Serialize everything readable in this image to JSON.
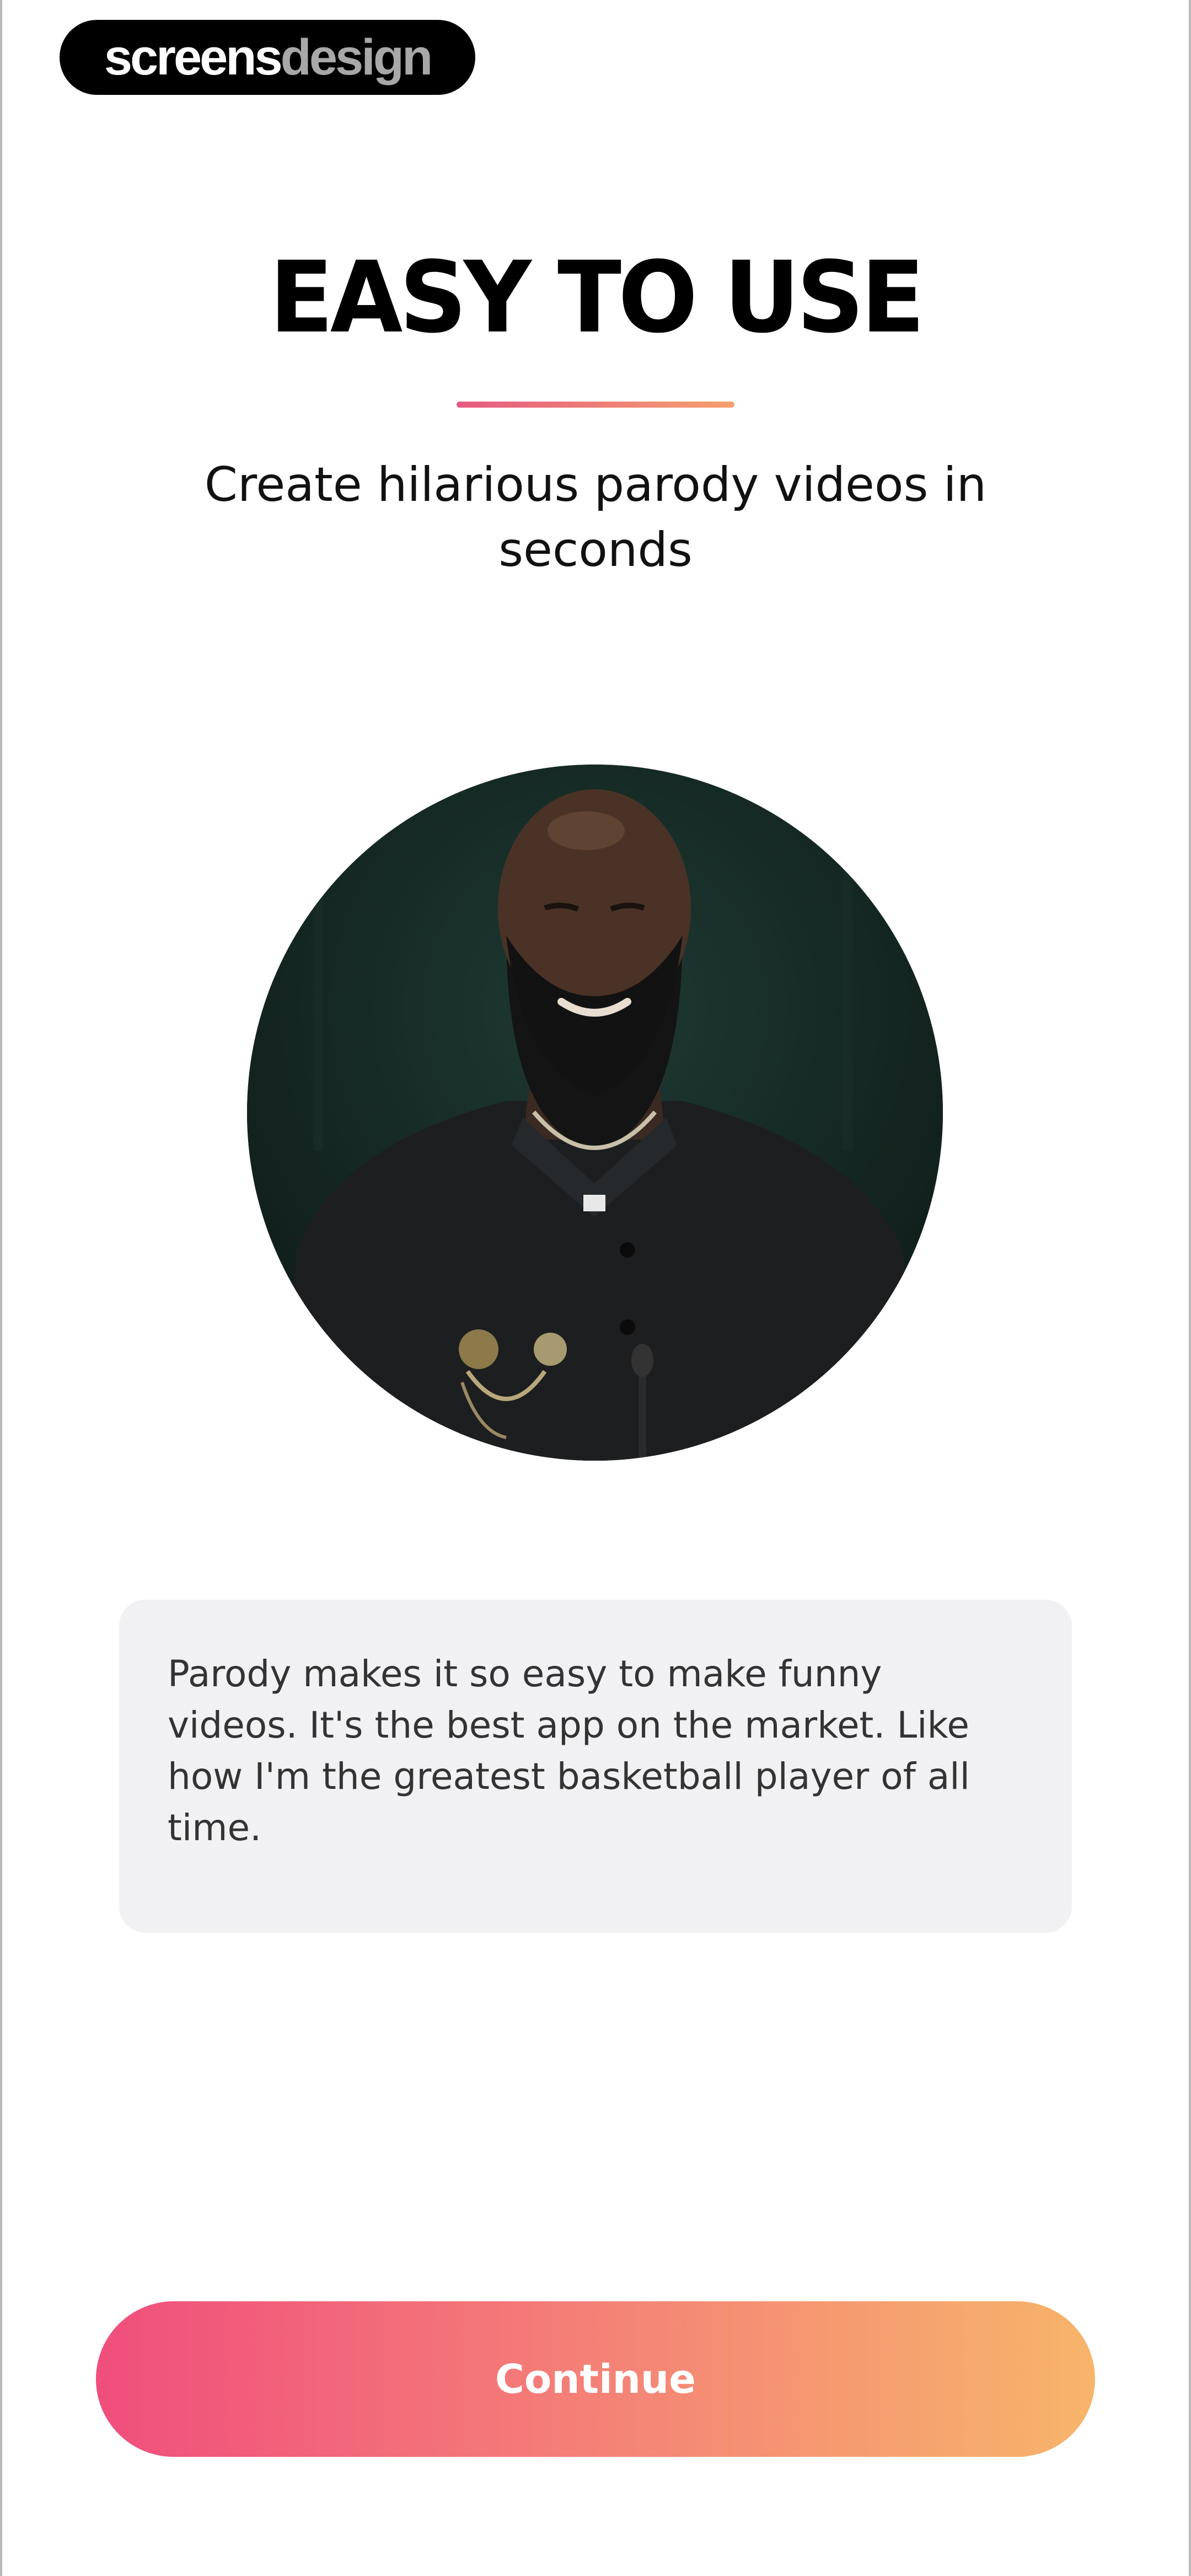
{
  "watermark": {
    "part1": "screens",
    "part2": "design"
  },
  "onboarding": {
    "title": "EASY TO USE",
    "subtitle": "Create hilarious parody videos in seconds",
    "quote": "Parody makes it so easy to make funny videos. It's the best app on the market. Like how I'm the greatest basketball player of all time.",
    "continue_label": "Continue"
  },
  "colors": {
    "accent_start": "#f04e7c",
    "accent_end": "#f7b56a",
    "card_background": "#f1f1f3"
  }
}
